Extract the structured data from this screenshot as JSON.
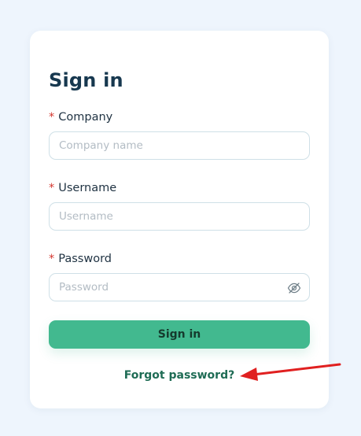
{
  "form": {
    "title": "Sign in",
    "required_marker": "*",
    "company": {
      "label": "Company",
      "placeholder": "Company name"
    },
    "username": {
      "label": "Username",
      "placeholder": "Username"
    },
    "password": {
      "label": "Password",
      "placeholder": "Password"
    },
    "submit_label": "Sign in",
    "forgot_label": "Forgot password?"
  },
  "icons": {
    "password_toggle": "eye-slash-icon",
    "annotation": "red-arrow"
  },
  "colors": {
    "page_bg": "#eef5fd",
    "card_bg": "#ffffff",
    "title": "#17384f",
    "required": "#d3362f",
    "button_bg": "#42b98f",
    "link": "#1f6c55",
    "annotation_arrow": "#e02020"
  }
}
